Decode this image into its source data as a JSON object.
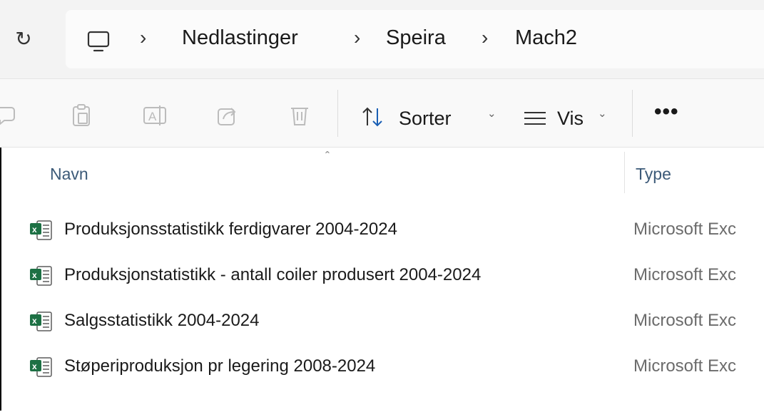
{
  "address_bar": {
    "refresh_icon": "refresh-icon",
    "computer_icon": "computer-icon",
    "breadcrumbs": [
      "Nedlastinger",
      "Speira",
      "Mach2"
    ]
  },
  "toolbar": {
    "icons": [
      "comment-icon",
      "paste-icon",
      "rename-icon",
      "share-icon",
      "delete-icon"
    ],
    "sort_label": "Sorter",
    "view_label": "Vis",
    "more_label": "•••"
  },
  "file_list": {
    "columns": [
      "Navn",
      "Type"
    ],
    "rows": [
      {
        "name": "Produksjonsstatistikk ferdigvarer 2004-2024",
        "type": "Microsoft Exc"
      },
      {
        "name": "Produksjonstatistikk - antall coiler produsert 2004-2024",
        "type": "Microsoft Exc"
      },
      {
        "name": "Salgsstatistikk 2004-2024",
        "type": "Microsoft Exc"
      },
      {
        "name": "Støperiproduksjon pr legering 2008-2024",
        "type": "Microsoft Exc"
      }
    ]
  },
  "colors": {
    "excel_green": "#1d7044",
    "header_text": "#3c5a78",
    "type_text": "#6b6b6b"
  }
}
